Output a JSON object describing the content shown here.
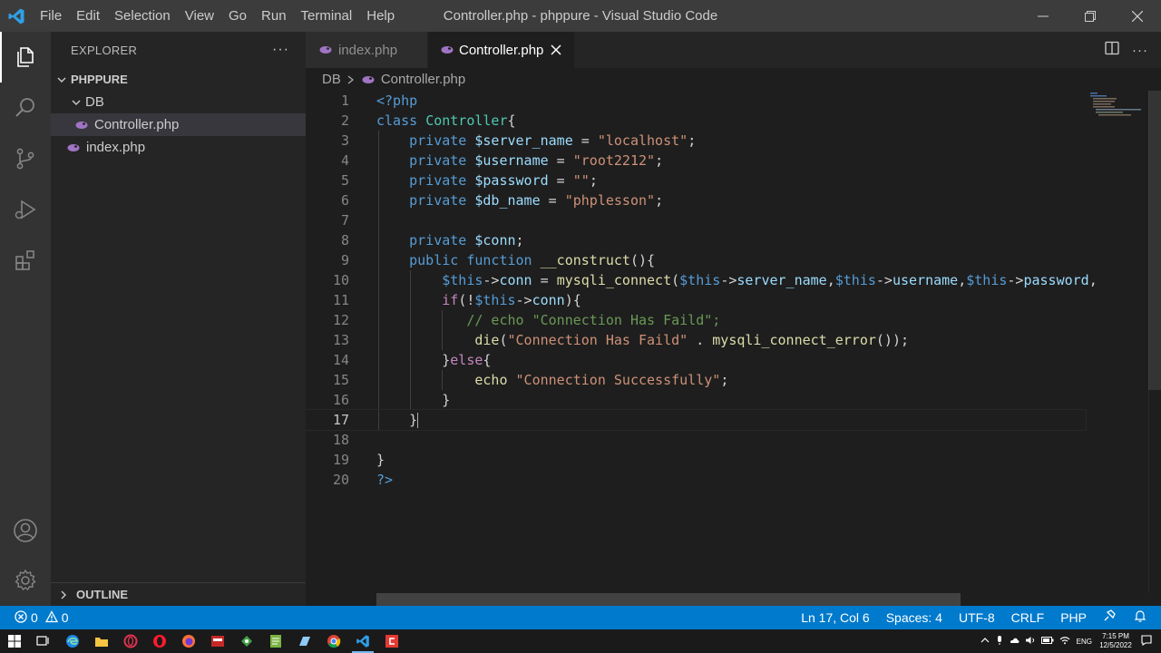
{
  "window": {
    "title": "Controller.php - phppure - Visual Studio Code",
    "menu": [
      "File",
      "Edit",
      "Selection",
      "View",
      "Go",
      "Run",
      "Terminal",
      "Help"
    ]
  },
  "sidebar": {
    "title": "EXPLORER",
    "more": "···",
    "root": "PHPPURE",
    "folder": "DB",
    "files": [
      "Controller.php",
      "index.php"
    ],
    "outline": "OUTLINE"
  },
  "tabs": [
    {
      "label": "index.php",
      "active": false
    },
    {
      "label": "Controller.php",
      "active": true
    }
  ],
  "breadcrumb": {
    "folder": "DB",
    "file": "Controller.php"
  },
  "editor": {
    "current_line": 17,
    "lines": [
      [
        [
          "kw",
          "<?php"
        ]
      ],
      [
        [
          "kw",
          "class "
        ],
        [
          "cls",
          "Controller"
        ],
        [
          "pl",
          "{"
        ]
      ],
      [
        [
          "pl",
          "    "
        ],
        [
          "kw",
          "private "
        ],
        [
          "var",
          "$server_name"
        ],
        [
          "pl",
          " = "
        ],
        [
          "str",
          "\"localhost\""
        ],
        [
          "pl",
          ";"
        ]
      ],
      [
        [
          "pl",
          "    "
        ],
        [
          "kw",
          "private "
        ],
        [
          "var",
          "$username"
        ],
        [
          "pl",
          " = "
        ],
        [
          "str",
          "\"root2212\""
        ],
        [
          "pl",
          ";"
        ]
      ],
      [
        [
          "pl",
          "    "
        ],
        [
          "kw",
          "private "
        ],
        [
          "var",
          "$password"
        ],
        [
          "pl",
          " = "
        ],
        [
          "str",
          "\"\""
        ],
        [
          "pl",
          ";"
        ]
      ],
      [
        [
          "pl",
          "    "
        ],
        [
          "kw",
          "private "
        ],
        [
          "var",
          "$db_name"
        ],
        [
          "pl",
          " = "
        ],
        [
          "str",
          "\"phplesson\""
        ],
        [
          "pl",
          ";"
        ]
      ],
      [],
      [
        [
          "pl",
          "    "
        ],
        [
          "kw",
          "private "
        ],
        [
          "var",
          "$conn"
        ],
        [
          "pl",
          ";"
        ]
      ],
      [
        [
          "pl",
          "    "
        ],
        [
          "kw",
          "public function "
        ],
        [
          "fn",
          "__construct"
        ],
        [
          "pl",
          "(){"
        ]
      ],
      [
        [
          "pl",
          "        "
        ],
        [
          "kw",
          "$this"
        ],
        [
          "pl",
          "->"
        ],
        [
          "var",
          "conn"
        ],
        [
          "pl",
          " = "
        ],
        [
          "fn",
          "mysqli_connect"
        ],
        [
          "pl",
          "("
        ],
        [
          "kw",
          "$this"
        ],
        [
          "pl",
          "->"
        ],
        [
          "var",
          "server_name"
        ],
        [
          "pl",
          ","
        ],
        [
          "kw",
          "$this"
        ],
        [
          "pl",
          "->"
        ],
        [
          "var",
          "username"
        ],
        [
          "pl",
          ","
        ],
        [
          "kw",
          "$this"
        ],
        [
          "pl",
          "->"
        ],
        [
          "var",
          "password"
        ],
        [
          "pl",
          ","
        ]
      ],
      [
        [
          "pl",
          "        "
        ],
        [
          "ctl",
          "if"
        ],
        [
          "pl",
          "(!"
        ],
        [
          "kw",
          "$this"
        ],
        [
          "pl",
          "->"
        ],
        [
          "var",
          "conn"
        ],
        [
          "pl",
          "){"
        ]
      ],
      [
        [
          "pl",
          "           "
        ],
        [
          "cm",
          "// echo \"Connection Has Faild\";"
        ]
      ],
      [
        [
          "pl",
          "            "
        ],
        [
          "fn",
          "die"
        ],
        [
          "pl",
          "("
        ],
        [
          "str",
          "\"Connection Has Faild\""
        ],
        [
          "pl",
          " . "
        ],
        [
          "fn",
          "mysqli_connect_error"
        ],
        [
          "pl",
          "());"
        ]
      ],
      [
        [
          "pl",
          "        }"
        ],
        [
          "ctl",
          "else"
        ],
        [
          "pl",
          "{"
        ]
      ],
      [
        [
          "pl",
          "            "
        ],
        [
          "fn",
          "echo "
        ],
        [
          "str",
          "\"Connection Successfully\""
        ],
        [
          "pl",
          ";"
        ]
      ],
      [
        [
          "pl",
          "        }"
        ]
      ],
      [
        [
          "pl",
          "    }"
        ]
      ],
      [],
      [
        [
          "pl",
          "}"
        ]
      ],
      [
        [
          "kw",
          "?>"
        ]
      ]
    ]
  },
  "status": {
    "errors": "0",
    "warnings": "0",
    "position": "Ln 17, Col 6",
    "spaces": "Spaces: 4",
    "encoding": "UTF-8",
    "eol": "CRLF",
    "language": "PHP"
  },
  "taskbar": {
    "lang": "ENG",
    "time": "7:15 PM",
    "date": "12/5/2022"
  },
  "colors": {
    "accent": "#007acc",
    "php_icon": "#a074c4"
  }
}
